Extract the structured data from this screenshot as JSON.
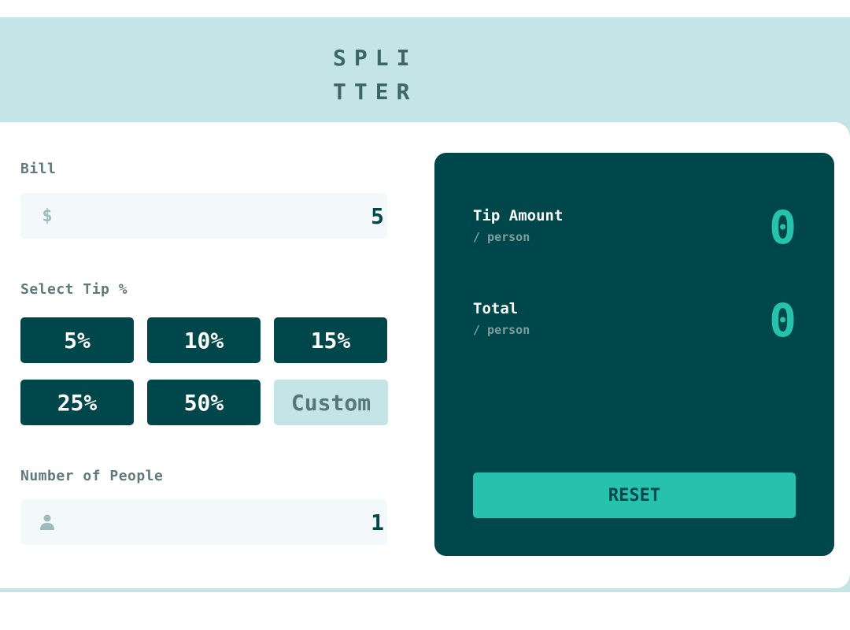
{
  "app": {
    "title_line1": "SPLI",
    "title_line2": "TTER"
  },
  "bill": {
    "label": "Bill",
    "currency_symbol": "$",
    "value": "5"
  },
  "tip": {
    "label": "Select Tip %",
    "options": [
      "5%",
      "10%",
      "15%",
      "25%",
      "50%"
    ],
    "custom_placeholder": "Custom"
  },
  "people": {
    "label": "Number of People",
    "icon": "person-icon",
    "value": "1"
  },
  "results": {
    "tip_amount_label": "Tip Amount",
    "tip_amount_sub": "/ person",
    "tip_amount_value": "0",
    "total_label": "Total",
    "total_sub": "/ person",
    "total_value": "0",
    "reset_label": "RESET"
  },
  "colors": {
    "background": "#c5e4e7",
    "dark_cyan": "#00474b",
    "accent": "#26c2ae",
    "input_bg": "#f3f9fa"
  }
}
